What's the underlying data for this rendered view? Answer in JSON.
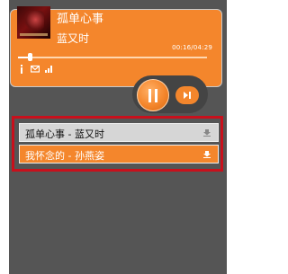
{
  "player": {
    "track_title": "孤单心事",
    "artist": "蓝又时",
    "time": "00:16/04:29",
    "progress_fraction": 0.06,
    "icons": [
      "info-icon",
      "mail-icon",
      "signal-icon"
    ],
    "controls": [
      "pause-icon",
      "next-icon"
    ]
  },
  "playlist": [
    {
      "text": "孤单心事 - 蓝又时",
      "state": "playing",
      "icon": "download-icon"
    },
    {
      "text": "我怀念的 - 孙燕姿",
      "state": "selected",
      "icon": "download-icon"
    }
  ],
  "colors": {
    "accent": "#f4862c",
    "background": "#555555",
    "highlight_border": "#c8101c",
    "row_inactive": "#d6d6d6"
  }
}
